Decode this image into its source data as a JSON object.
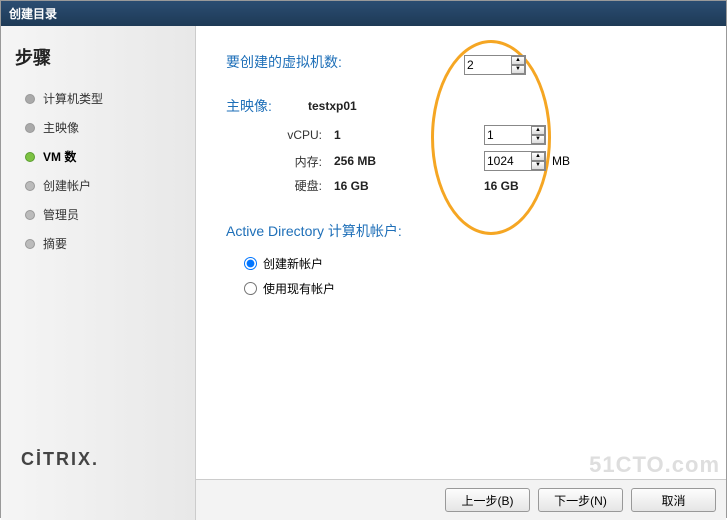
{
  "titlebar": "创建目录",
  "sidebar": {
    "title": "步骤",
    "items": [
      {
        "label": "计算机类型"
      },
      {
        "label": "主映像"
      },
      {
        "label": "VM 数"
      },
      {
        "label": "创建帐户"
      },
      {
        "label": "管理员"
      },
      {
        "label": "摘要"
      }
    ]
  },
  "main": {
    "vm_count_label": "要创建的虚拟机数:",
    "vm_count_value": "2",
    "master_image_label": "主映像:",
    "master_image_value": "testxp01",
    "specs": {
      "vcpu_label": "vCPU:",
      "vcpu_orig": "1",
      "vcpu_input": "1",
      "mem_label": "内存:",
      "mem_orig": "256 MB",
      "mem_input": "1024",
      "mem_unit": "MB",
      "disk_label": "硬盘:",
      "disk_orig": "16 GB",
      "disk_new": "16 GB"
    },
    "ad_heading": "Active Directory 计算机帐户:",
    "radio_create": "创建新帐户",
    "radio_existing": "使用现有帐户"
  },
  "footer": {
    "back": "上一步(B)",
    "next": "下一步(N)",
    "cancel": "取消"
  },
  "logo": "CİTRIX",
  "watermark": "51CTO.com"
}
